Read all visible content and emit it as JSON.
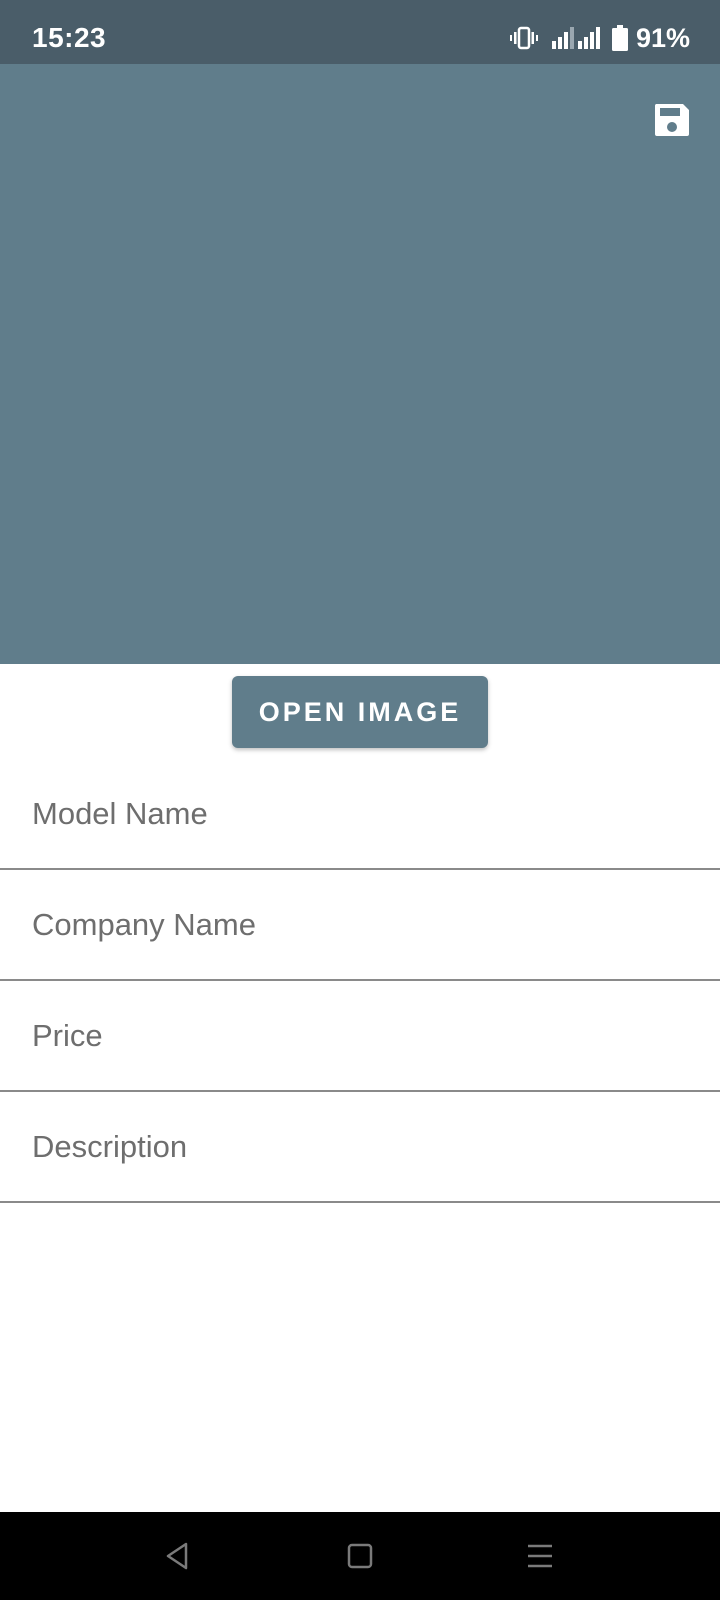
{
  "status_bar": {
    "time": "15:23",
    "battery": "91%",
    "icons": [
      "vibrate-icon",
      "signal-icon",
      "signal-icon",
      "battery-icon"
    ]
  },
  "toolbar": {
    "save_icon": "save-icon"
  },
  "image_area": {
    "background_color": "#607d8b"
  },
  "open_image_button": {
    "label": "OPEN IMAGE"
  },
  "form": {
    "model_name_placeholder": "Model Name",
    "company_name_placeholder": "Company Name",
    "price_placeholder": "Price",
    "description_placeholder": "Description"
  },
  "nav_bar": {
    "icons": [
      "back-icon",
      "home-icon",
      "menu-icon"
    ]
  }
}
